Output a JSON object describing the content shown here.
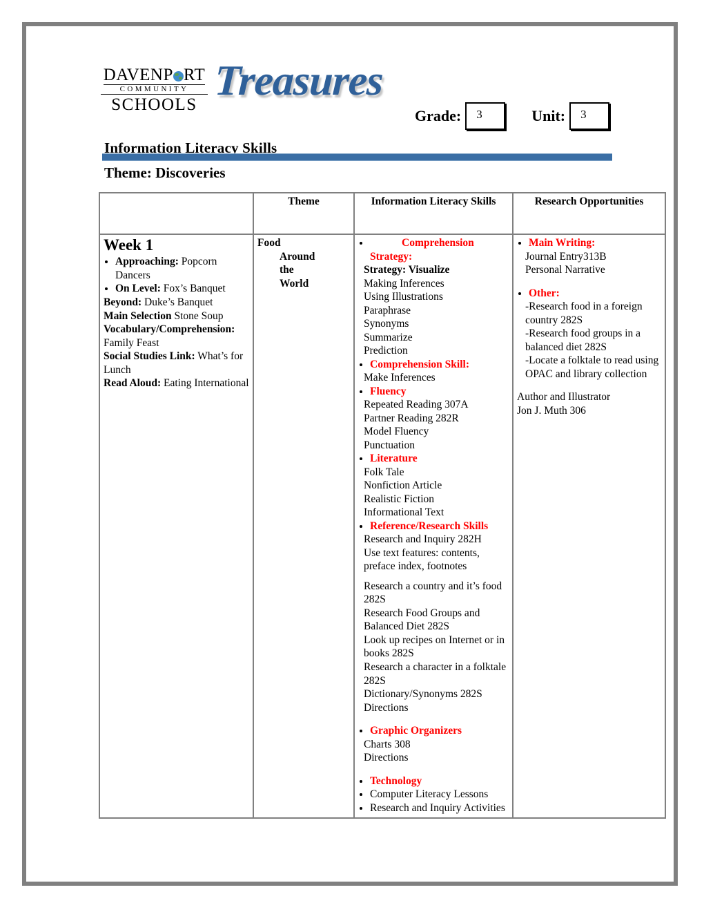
{
  "document": {
    "logo": {
      "line1": "DAVENP",
      "globe": "globe-icon",
      "line1b": "RT",
      "line2": "COMMUNITY",
      "line3": "SCHOOLS"
    },
    "brand": "Treasures",
    "grade": {
      "label": "Grade:",
      "value": "3"
    },
    "unit": {
      "label": "Unit:",
      "value": "3"
    },
    "section_title": "Information Literacy Skills",
    "theme_title": "Theme: Discoveries",
    "accent_blue": "#3a6ea5",
    "accent_red": "#ff0000",
    "border_gray": "#808080"
  },
  "table": {
    "headers": [
      "",
      "Theme",
      "Information Literacy Skills",
      "Research Opportunities"
    ],
    "week": {
      "title": "Week 1",
      "items": [
        {
          "bullet": true,
          "label": "Approaching",
          "sep": ":",
          "value": " Popcorn Dancers"
        },
        {
          "bullet": true,
          "label": "On Level:",
          "sep": "",
          "value": " Fox’s Banquet"
        },
        {
          "bullet": false,
          "label": "Beyond:",
          "sep": "",
          "value": " Duke’s Banquet"
        },
        {
          "bullet": false,
          "label": "Main Selection",
          "sep": "",
          "value": " Stone Soup"
        },
        {
          "bullet": false,
          "label": "Vocabulary/Comprehension:",
          "sep": "",
          "value": " Family Feast"
        },
        {
          "bullet": false,
          "label": "Social Studies Link:",
          "sep": "",
          "value": "  What’s for Lunch"
        },
        {
          "bullet": false,
          "label": "Read Aloud:",
          "sep": "",
          "value": " Eating International"
        }
      ]
    },
    "theme": {
      "line1": "Food",
      "line2": "Around",
      "line3": "the",
      "line4": "World"
    },
    "literacy_skills": [
      {
        "heading": "Comprehension Strategy:",
        "heading_indent": true,
        "lines": [
          {
            "text": "Strategy:  Visualize",
            "bold": true
          },
          {
            "text": "Making Inferences",
            "bold": false
          },
          {
            "text": "Using Illustrations",
            "bold": false
          },
          {
            "text": "Paraphrase",
            "bold": false
          },
          {
            "text": "Synonyms",
            "bold": false
          },
          {
            "text": "Summarize",
            "bold": false
          },
          {
            "text": "Prediction",
            "bold": false
          }
        ]
      },
      {
        "heading": "Comprehension Skill:",
        "lines": [
          {
            "text": "Make Inferences",
            "bold": false
          }
        ]
      },
      {
        "heading": "Fluency",
        "lines": [
          {
            "text": "Repeated Reading 307A",
            "bold": false
          },
          {
            "text": "Partner Reading 282R",
            "bold": false
          },
          {
            "text": "Model Fluency",
            "bold": false
          },
          {
            "text": "Punctuation",
            "bold": false
          }
        ]
      },
      {
        "heading": "Literature",
        "lines": [
          {
            "text": "Folk Tale",
            "bold": false
          },
          {
            "text": "Nonfiction Article",
            "bold": false
          },
          {
            "text": "Realistic Fiction",
            "bold": false
          },
          {
            "text": "Informational Text",
            "bold": false
          }
        ]
      },
      {
        "heading": "Reference/Research Skills",
        "lines": [
          {
            "text": "Research and Inquiry 282H",
            "bold": false
          },
          {
            "text": " Use text features: contents, preface index, footnotes",
            "bold": false
          },
          {
            "text": "",
            "bold": false,
            "spacer": true
          },
          {
            "text": " Research a country and it’s food 282S",
            "bold": false
          },
          {
            "text": " Research  Food Groups and Balanced Diet 282S",
            "bold": false
          },
          {
            "text": " Look up recipes on Internet or in books 282S",
            "bold": false
          },
          {
            "text": " Research a character in a folktale 282S",
            "bold": false
          },
          {
            "text": " Dictionary/Synonyms  282S",
            "bold": false
          },
          {
            "text": " Directions",
            "bold": false
          }
        ]
      },
      {
        "heading": "Graphic Organizers",
        "spacer_before": true,
        "lines": [
          {
            "text": "Charts 308",
            "bold": false
          },
          {
            "text": "Directions",
            "bold": false
          }
        ]
      },
      {
        "heading": "Technology",
        "spacer_before": true,
        "extra_bullets": [
          "Computer Literacy Lessons",
          "Research and Inquiry Activities"
        ],
        "lines": []
      }
    ],
    "research_opportunities": {
      "groups": [
        {
          "heading": "Main Writing:",
          "lines": [
            "Journal Entry313B",
            "Personal Narrative"
          ]
        },
        {
          "heading": "Other:",
          "spacer_before": true,
          "lines": [
            "-Research food in a foreign country  282S",
            "-Research food groups in a balanced diet 282S",
            "-Locate a folktale to read using OPAC  and library collection"
          ]
        }
      ],
      "footer": [
        "Author and Illustrator",
        "Jon J. Muth 306"
      ]
    }
  }
}
